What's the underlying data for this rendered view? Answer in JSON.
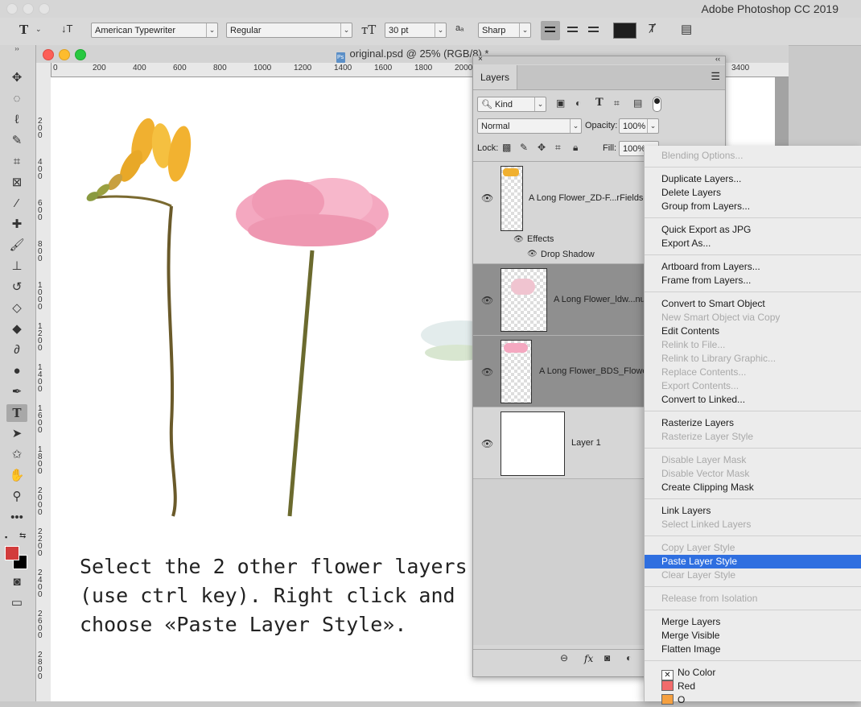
{
  "app": {
    "title": "Adobe Photoshop CC 2019"
  },
  "options_bar": {
    "font_family": "American Typewriter",
    "font_style": "Regular",
    "font_size": "30 pt",
    "aa_label": "a",
    "antialias": "Sharp",
    "color_swatch": "#1e1e1e"
  },
  "document": {
    "title": "original.psd @ 25% (RGB/8) *",
    "ruler_h": [
      "0",
      "200",
      "400",
      "600",
      "800",
      "1000",
      "1200",
      "1400",
      "1600",
      "1800",
      "2000",
      "3400"
    ],
    "ruler_v": [
      "2 0 0",
      "4 0 0",
      "6 0 0",
      "8 0 0",
      "1 0 0 0",
      "1 2 0 0",
      "1 4 0 0",
      "1 6 0 0",
      "1 8 0 0",
      "2 0 0 0",
      "2 2 0 0",
      "2 4 0 0",
      "2 6 0 0",
      "2 8 0 0"
    ],
    "caption": [
      "Select the 2 other flower layers",
      "(use ctrl key). Right click and",
      "choose «Paste Layer Style»."
    ]
  },
  "layers_panel": {
    "tab": "Layers",
    "filter_kind": "Kind",
    "blend_mode": "Normal",
    "opacity_label": "Opacity:",
    "opacity_value": "100%",
    "lock_label": "Lock:",
    "fill_label": "Fill:",
    "fill_value": "100%",
    "layers": [
      {
        "name": "A Long Flower_ZD-F...rFields-",
        "effects_label": "Effects",
        "effect": "Drop Shadow"
      },
      {
        "name": "A Long Flower_ldw...nus"
      },
      {
        "name": "A Long Flower_BDS_Flower"
      },
      {
        "name": "Layer 1"
      }
    ],
    "footer_fx": "fx"
  },
  "context_menu": {
    "items": [
      {
        "label": "Blending Options...",
        "disabled": true
      },
      {
        "label": "Duplicate Layers..."
      },
      {
        "label": "Delete Layers"
      },
      {
        "label": "Group from Layers..."
      },
      {
        "label": "Quick Export as JPG"
      },
      {
        "label": "Export As..."
      },
      {
        "label": "Artboard from Layers..."
      },
      {
        "label": "Frame from Layers..."
      },
      {
        "label": "Convert to Smart Object"
      },
      {
        "label": "New Smart Object via Copy",
        "disabled": true
      },
      {
        "label": "Edit Contents"
      },
      {
        "label": "Relink to File...",
        "disabled": true
      },
      {
        "label": "Relink to Library Graphic...",
        "disabled": true
      },
      {
        "label": "Replace Contents...",
        "disabled": true
      },
      {
        "label": "Export Contents...",
        "disabled": true
      },
      {
        "label": "Convert to Linked..."
      },
      {
        "label": "Rasterize Layers"
      },
      {
        "label": "Rasterize Layer Style",
        "disabled": true
      },
      {
        "label": "Disable Layer Mask",
        "disabled": true
      },
      {
        "label": "Disable Vector Mask",
        "disabled": true
      },
      {
        "label": "Create Clipping Mask"
      },
      {
        "label": "Link Layers"
      },
      {
        "label": "Select Linked Layers",
        "disabled": true
      },
      {
        "label": "Copy Layer Style",
        "disabled": true
      },
      {
        "label": "Paste Layer Style",
        "highlighted": true
      },
      {
        "label": "Clear Layer Style",
        "disabled": true
      },
      {
        "label": "Release from Isolation",
        "disabled": true
      },
      {
        "label": "Merge Layers"
      },
      {
        "label": "Merge Visible"
      },
      {
        "label": "Flatten Image"
      },
      {
        "label": "No Color",
        "swatch": "none"
      },
      {
        "label": "Red",
        "swatch": "#f26b6b"
      },
      {
        "label": "O",
        "swatch": "#f5a040"
      }
    ]
  },
  "colors": {
    "foreground": "#d23c3c",
    "background": "#000000",
    "highlight": "#2f6fe0"
  }
}
